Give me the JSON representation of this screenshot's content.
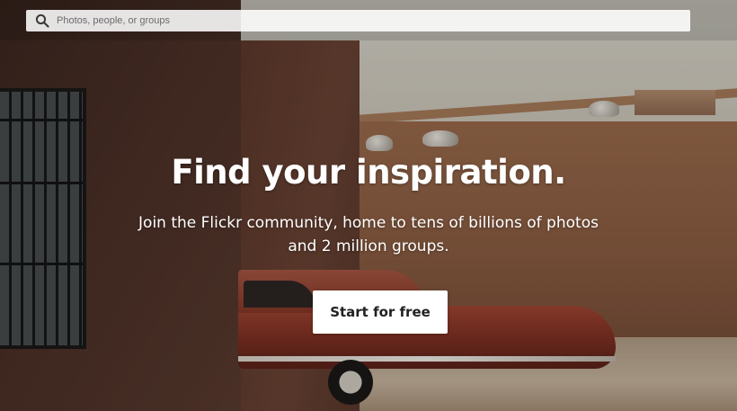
{
  "search": {
    "placeholder": "Photos, people, or groups",
    "value": "",
    "icon": "search-icon"
  },
  "hero": {
    "title": "Find your inspiration.",
    "subtitle": "Join the Flickr community, home to tens of billions of photos and 2 million groups.",
    "cta_label": "Start for free"
  },
  "colors": {
    "hero_text": "#ffffff",
    "cta_background": "#ffffff",
    "cta_text": "#212124"
  }
}
